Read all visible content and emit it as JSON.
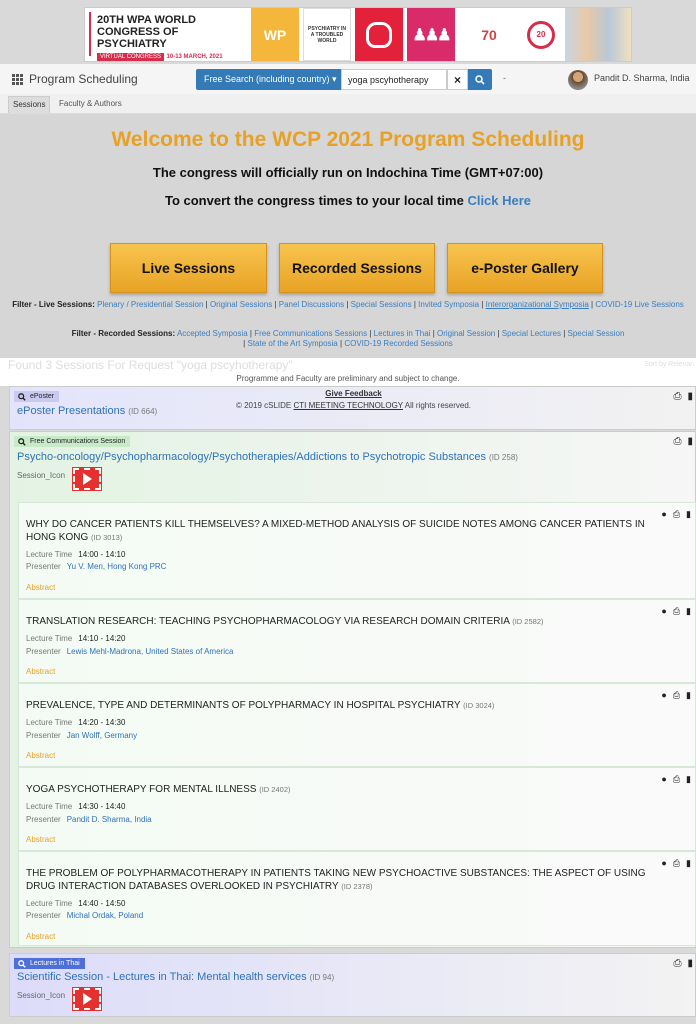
{
  "banner": {
    "wpa_line1": "20TH WPA WORLD",
    "wpa_line2": "CONGRESS OF PSYCHIATRY",
    "virtual_label": "VIRTUAL CONGRESS",
    "dates": "10-13 MARCH, 2021",
    "tile_wp": "WP",
    "tile_psychiatry": "PSYCHIATRY IN A TROUBLED WORLD",
    "tile_70": "70",
    "tile_20": "20"
  },
  "header": {
    "app_title": "Program Scheduling",
    "search_scope": "Free Search (including country) ▾",
    "search_value": "yoga pscyhotherapy",
    "clear_label": "×",
    "dash": "-",
    "user_name": "Pandit D. Sharma, India"
  },
  "tabs": [
    {
      "label": "Sessions"
    },
    {
      "label": "Faculty & Authors"
    }
  ],
  "welcome": {
    "title": "Welcome to the WCP 2021 Program Scheduling",
    "line2": "The congress will officially run on Indochina Time (GMT+07:00)",
    "line3": "To convert the congress times to your local time",
    "click_here": "Click Here"
  },
  "buttons": {
    "live": "Live Sessions",
    "recorded": "Recorded Sessions",
    "eposter": "e-Poster Gallery"
  },
  "filters": {
    "live_label": "Filter - Live Sessions:",
    "live_items": [
      "Plenary / Presidential Session",
      "Original Sessions",
      "Panel Discussions",
      "Special Sessions",
      "Invited Symposia",
      "Interorganizational Symposia",
      "COVID-19 Live Sessions"
    ],
    "recorded_label": "Filter - Recorded Sessions:",
    "recorded_items": [
      "Accepted Symposia",
      "Free Communications Sessions",
      "Lectures in Thai",
      "Original Session",
      "Special Lectures",
      "Special Session",
      "State of the Art Symposia",
      "COVID-19 Recorded Sessions"
    ]
  },
  "results": {
    "found_text": "Found 3 Sessions For Request \"yoga pscyhotherapy\"",
    "sort_text": "Sort by Relevan",
    "prelim": "Programme and Faculty are preliminary and subject to change.",
    "feedback": "Give Feedback",
    "copyright_pre": "© 2019 cSLIDE",
    "copyright_link": "CTI MEETING TECHNOLOGY",
    "copyright_post": "All rights reserved."
  },
  "sessions": [
    {
      "tag": "ePoster",
      "title": "ePoster Presentations",
      "id": "(ID 664)"
    },
    {
      "tag": "Free Communications Session",
      "title": "Psycho-oncology/Psychopharmacology/Psychotherapies/Addictions to Psychotropic Substances",
      "id": "(ID 258)",
      "icon_label": "Session_Icon"
    },
    {
      "tag": "Lectures in Thai",
      "title": "Scientific Session - Lectures in Thai: Mental health services",
      "id": "(ID 94)",
      "icon_label": "Session_Icon"
    }
  ],
  "labels": {
    "lecture_time": "Lecture Time",
    "presenter": "Presenter",
    "abstract": "Abstract"
  },
  "abstracts": [
    {
      "title": "WHY DO CANCER PATIENTS KILL THEMSELVES? A MIXED-METHOD ANALYSIS OF SUICIDE NOTES AMONG CANCER PATIENTS IN HONG KONG",
      "id": "(ID 3013)",
      "time": "14:00 - 14:10",
      "presenter": "Yu V. Men, Hong Kong PRC"
    },
    {
      "title": "TRANSLATION RESEARCH: TEACHING PSYCHOPHARMACOLOGY VIA RESEARCH DOMAIN CRITERIA",
      "id": "(ID 2582)",
      "time": "14:10 - 14:20",
      "presenter": "Lewis Mehl-Madrona, United States of America"
    },
    {
      "title": "PREVALENCE, TYPE AND DETERMINANTS OF POLYPHARMACY IN HOSPITAL PSYCHIATRY",
      "id": "(ID 3024)",
      "time": "14:20 - 14:30",
      "presenter": "Jan Wolff, Germany"
    },
    {
      "title": "YOGA PSYCHOTHERAPY FOR MENTAL ILLNESS",
      "id": "(ID 2402)",
      "time": "14:30 - 14:40",
      "presenter": "Pandit D. Sharma, India"
    },
    {
      "title": "THE PROBLEM OF POLYPHARMACOTHERAPY IN PATIENTS TAKING NEW PSYCHOACTIVE SUBSTANCES: THE ASPECT OF USING DRUG INTERACTION DATABASES OVERLOOKED IN PSYCHIATRY",
      "id": "(ID 2378)",
      "time": "14:40 - 14:50",
      "presenter": "Michal Ordak, Poland"
    }
  ]
}
